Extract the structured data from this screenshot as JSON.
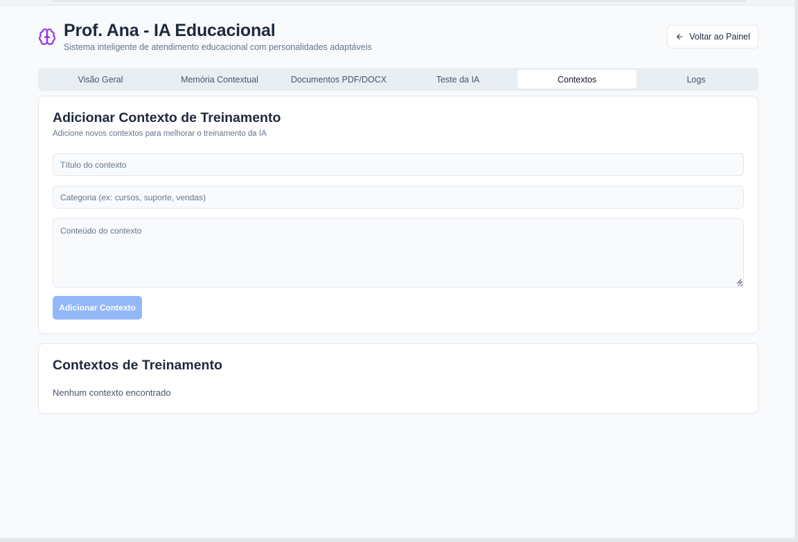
{
  "header": {
    "title": "Prof. Ana - IA Educacional",
    "subtitle": "Sistema inteligente de atendimento educacional com personalidades adaptáveis",
    "back_button": "Voltar ao Painel",
    "brand_icon": "brain-icon",
    "brand_color": "#9333ea"
  },
  "tabs": [
    {
      "label": "Visão Geral",
      "active": false
    },
    {
      "label": "Memória Contextual",
      "active": false
    },
    {
      "label": "Documentos PDF/DOCX",
      "active": false
    },
    {
      "label": "Teste da IA",
      "active": false
    },
    {
      "label": "Contextos",
      "active": true
    },
    {
      "label": "Logs",
      "active": false
    }
  ],
  "add_context": {
    "title": "Adicionar Contexto de Treinamento",
    "description": "Adicione novos contextos para melhorar o treinamento da IA",
    "title_field": {
      "placeholder": "Título do contexto",
      "value": ""
    },
    "category_field": {
      "placeholder": "Categoria (ex: cursos, suporte, vendas)",
      "value": ""
    },
    "content_field": {
      "placeholder": "Conteúdo do contexto",
      "value": ""
    },
    "submit_label": "Adicionar Contexto",
    "submit_disabled": true,
    "submit_color": "#93b8f9"
  },
  "context_list": {
    "title": "Contextos de Treinamento",
    "empty_message": "Nenhum contexto encontrado"
  }
}
